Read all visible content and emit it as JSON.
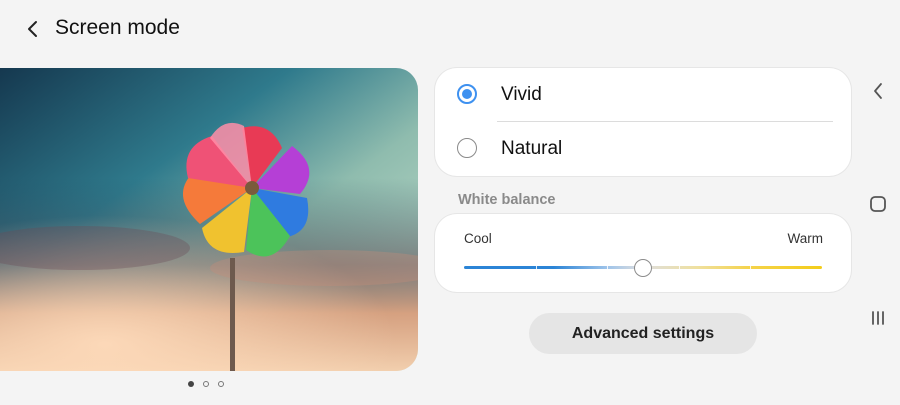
{
  "header": {
    "title": "Screen mode",
    "back_icon": "chevron-left-icon"
  },
  "preview": {
    "image": "colorful-pinwheel-photo",
    "page_count": 3,
    "active_page": 1
  },
  "screen_mode": {
    "options": [
      {
        "label": "Vivid",
        "selected": true
      },
      {
        "label": "Natural",
        "selected": false
      }
    ],
    "accent_color": "#3e91f0"
  },
  "white_balance": {
    "section_label": "White balance",
    "min_label": "Cool",
    "max_label": "Warm",
    "value_fraction": 0.5,
    "steps": 5,
    "colors": {
      "cool": "#2b84d6",
      "warm": "#f3cd1a"
    }
  },
  "advanced_button": {
    "label": "Advanced settings"
  },
  "navigation_bar": {
    "icons": [
      "nav-back-icon",
      "nav-home-icon",
      "nav-recents-icon"
    ]
  }
}
